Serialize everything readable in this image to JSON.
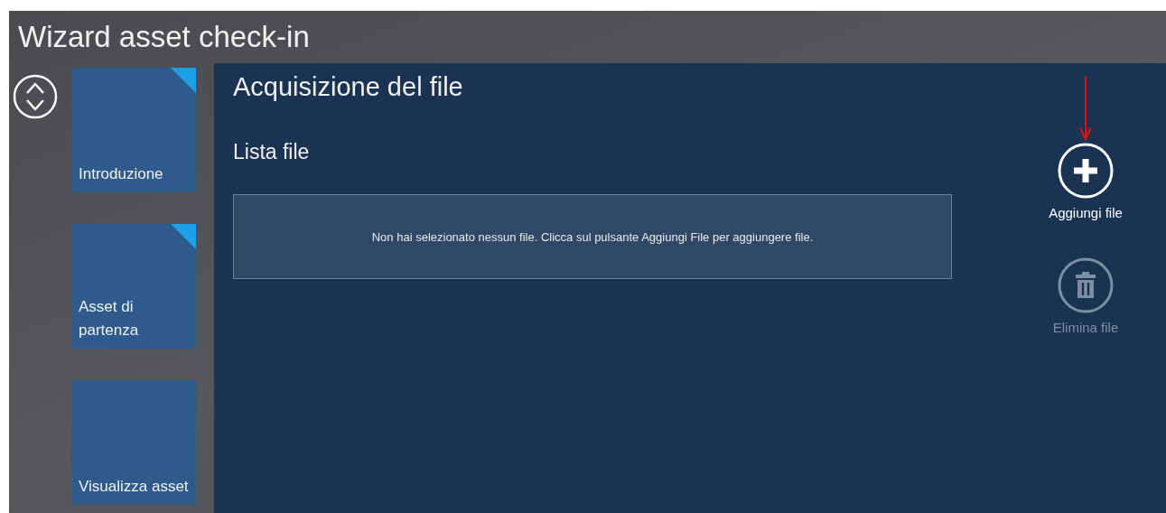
{
  "window": {
    "title": "Wizard asset check-in"
  },
  "steps": [
    {
      "label": "Introduzione",
      "completed": true
    },
    {
      "label": "Asset di partenza",
      "completed": true
    },
    {
      "label": "Visualizza asset",
      "completed": false
    }
  ],
  "page": {
    "title": "Acquisizione del file",
    "section": "Lista file",
    "empty_message": "Non hai selezionato nessun file. Clicca sul pulsante Aggiungi File per aggiungere file."
  },
  "actions": [
    {
      "kind": "add",
      "label": "Aggiungi file",
      "disabled": false
    },
    {
      "kind": "delete",
      "label": "Elimina file",
      "disabled": true
    }
  ]
}
